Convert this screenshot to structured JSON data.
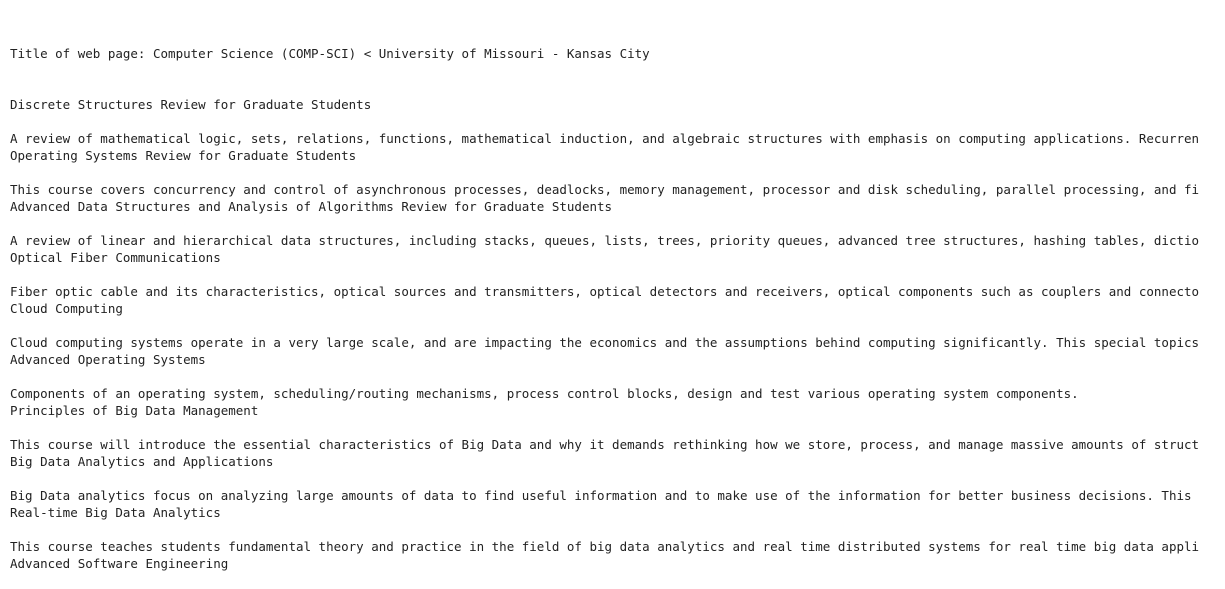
{
  "page_title_line": "Title of web page: Computer Science (COMP-SCI) < University of Missouri - Kansas City",
  "courses": [
    {
      "title": "Discrete Structures Review for Graduate Students",
      "description": "A review of mathematical logic, sets, relations, functions, mathematical induction, and algebraic structures with emphasis on computing applications. Recurren"
    },
    {
      "title": "Operating Systems Review for Graduate Students",
      "description": "This course covers concurrency and control of asynchronous processes, deadlocks, memory management, processor and disk scheduling, parallel processing, and fi"
    },
    {
      "title": "Advanced Data Structures and Analysis of Algorithms Review for Graduate Students",
      "description": "A review of linear and hierarchical data structures, including stacks, queues, lists, trees, priority queues, advanced tree structures, hashing tables, dictio"
    },
    {
      "title": "Optical Fiber Communications",
      "description": "Fiber optic cable and its characteristics, optical sources and transmitters, optical detectors and receivers, optical components such as couplers and connecto"
    },
    {
      "title": "Cloud Computing",
      "description": "Cloud computing systems operate in a very large scale, and are impacting the economics and the assumptions behind computing significantly. This special topics"
    },
    {
      "title": "Advanced Operating Systems",
      "description": "Components of an operating system, scheduling/routing mechanisms, process control blocks, design and test various operating system components."
    },
    {
      "title": "Principles of Big Data Management",
      "description": "This course will introduce the essential characteristics of Big Data and why it demands rethinking how we store, process, and manage massive amounts of struct"
    },
    {
      "title": "Big Data Analytics and Applications",
      "description": "Big Data analytics focus on analyzing large amounts of data to find useful information and to make use of the information for better business decisions. This"
    },
    {
      "title": "Real-time Big Data Analytics",
      "description": "This course teaches students fundamental theory and practice in the field of big data analytics and real time distributed systems for real time big data appli"
    },
    {
      "title": "Advanced Software Engineering",
      "description": ""
    }
  ]
}
